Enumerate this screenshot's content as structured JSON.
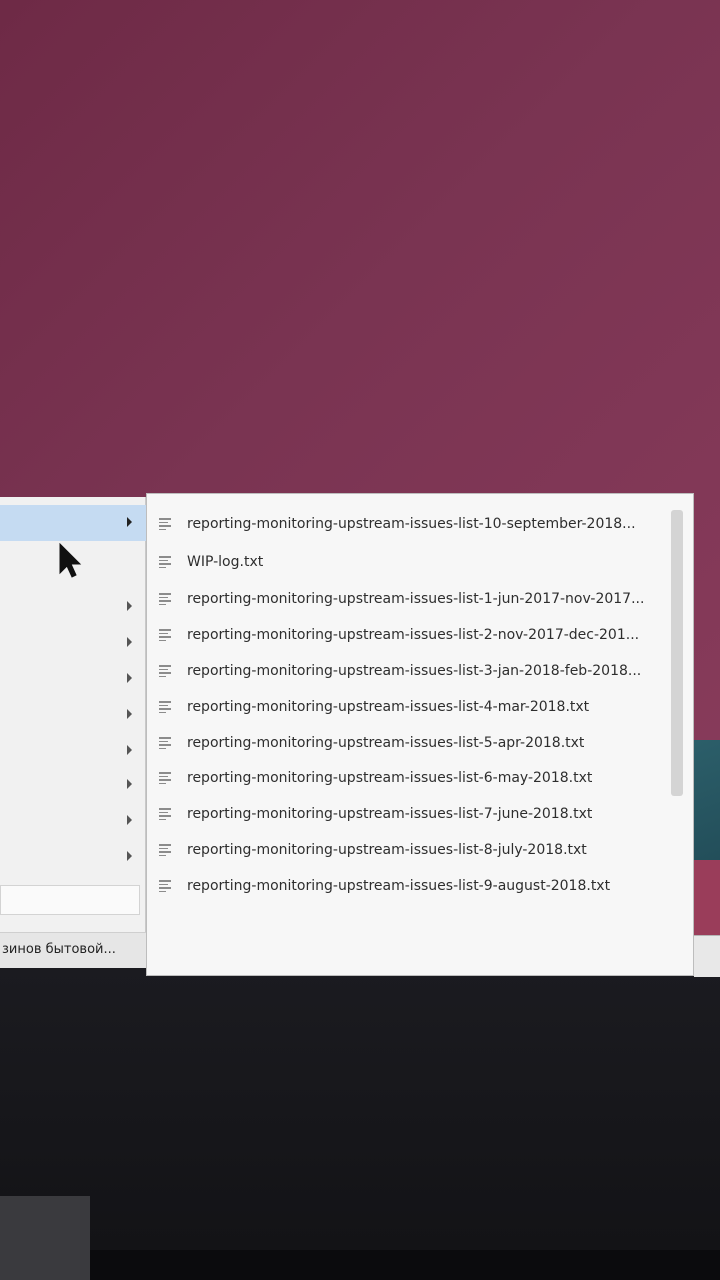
{
  "colors": {
    "wallpaper": "#7a3452",
    "menu_bg": "#f1f1f1",
    "menu_highlight": "#c5dbf2",
    "submenu_bg": "#f7f7f7",
    "text": "#2e2e2e",
    "bezel": "#151519"
  },
  "app_menu": {
    "categories": [
      {
        "label": "",
        "active": true
      },
      {
        "label": "",
        "active": false
      },
      {
        "label": "",
        "active": false
      },
      {
        "label": "",
        "active": false
      },
      {
        "label": "",
        "active": false
      },
      {
        "label": "",
        "active": false
      },
      {
        "label": "",
        "active": false
      },
      {
        "label": "",
        "active": false
      },
      {
        "label": "",
        "active": false
      },
      {
        "label": "",
        "active": false
      }
    ],
    "search": {
      "placeholder": ""
    }
  },
  "taskbar": {
    "window_title": "зинов бытовой..."
  },
  "recent_files": {
    "items": [
      {
        "name": "reporting-monitoring-upstream-issues-list-10-september-2018...",
        "icon": "text-file-icon"
      },
      {
        "name": "WIP-log.txt",
        "icon": "text-file-icon"
      },
      {
        "name": "reporting-monitoring-upstream-issues-list-1-jun-2017-nov-2017...",
        "icon": "text-file-icon"
      },
      {
        "name": "reporting-monitoring-upstream-issues-list-2-nov-2017-dec-201...",
        "icon": "text-file-icon"
      },
      {
        "name": "reporting-monitoring-upstream-issues-list-3-jan-2018-feb-2018...",
        "icon": "text-file-icon"
      },
      {
        "name": "reporting-monitoring-upstream-issues-list-4-mar-2018.txt",
        "icon": "text-file-icon"
      },
      {
        "name": "reporting-monitoring-upstream-issues-list-5-apr-2018.txt",
        "icon": "text-file-icon"
      },
      {
        "name": "reporting-monitoring-upstream-issues-list-6-may-2018.txt",
        "icon": "text-file-icon"
      },
      {
        "name": "reporting-monitoring-upstream-issues-list-7-june-2018.txt",
        "icon": "text-file-icon"
      },
      {
        "name": "reporting-monitoring-upstream-issues-list-8-july-2018.txt",
        "icon": "text-file-icon"
      },
      {
        "name": "reporting-monitoring-upstream-issues-list-9-august-2018.txt",
        "icon": "text-file-icon"
      }
    ]
  }
}
